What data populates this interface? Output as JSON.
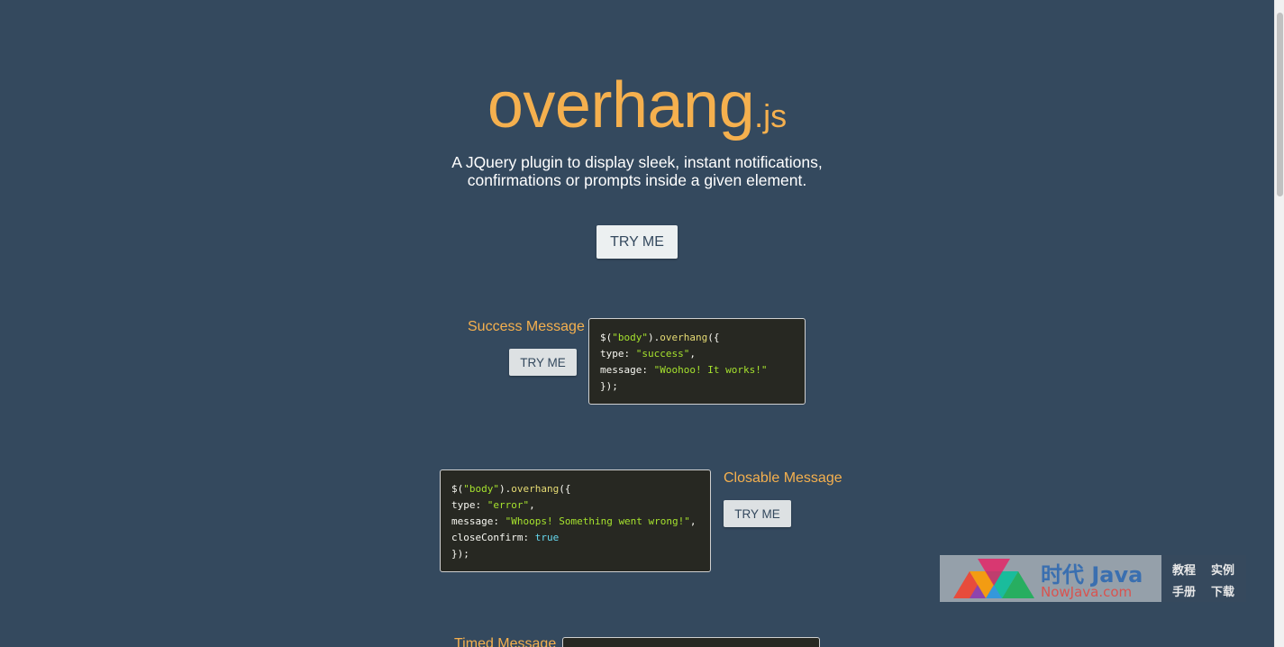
{
  "hero": {
    "title_main": "overhang",
    "title_ext": ".js",
    "subtitle_line1": "A JQuery plugin to display sleek, instant notifications,",
    "subtitle_line2": "confirmations or prompts inside a given element.",
    "button_label": "TRY ME"
  },
  "sections": [
    {
      "title": "Success Message",
      "button_label": "TRY ME",
      "code": {
        "l1_a": "$(",
        "l1_b": "\"body\"",
        "l1_c": ").",
        "l1_d": "overhang",
        "l1_e": "({",
        "l2_a": "type: ",
        "l2_b": "\"success\"",
        "l2_c": ",",
        "l3_a": "message: ",
        "l3_b": "\"Woohoo! It works!\"",
        "l4": "});"
      }
    },
    {
      "title": "Closable Message",
      "button_label": "TRY ME",
      "code": {
        "l1_a": "$(",
        "l1_b": "\"body\"",
        "l1_c": ").",
        "l1_d": "overhang",
        "l1_e": "({",
        "l2_a": "type: ",
        "l2_b": "\"error\"",
        "l2_c": ",",
        "l3_a": "message: ",
        "l3_b": "\"Whoops! Something went wrong!\"",
        "l3_c": ",",
        "l4_a": "closeConfirm: ",
        "l4_b": "true",
        "l5": "});"
      }
    },
    {
      "title": "Timed Message"
    }
  ],
  "watermark": {
    "brand": "时代 Java",
    "url": "NowJava.com",
    "cell1": "教程",
    "cell2": "实例",
    "cell3": "手册",
    "cell4": "下载"
  },
  "colors": {
    "background": "#34495e",
    "accent": "#f5b04e",
    "code_bg": "#272822"
  }
}
